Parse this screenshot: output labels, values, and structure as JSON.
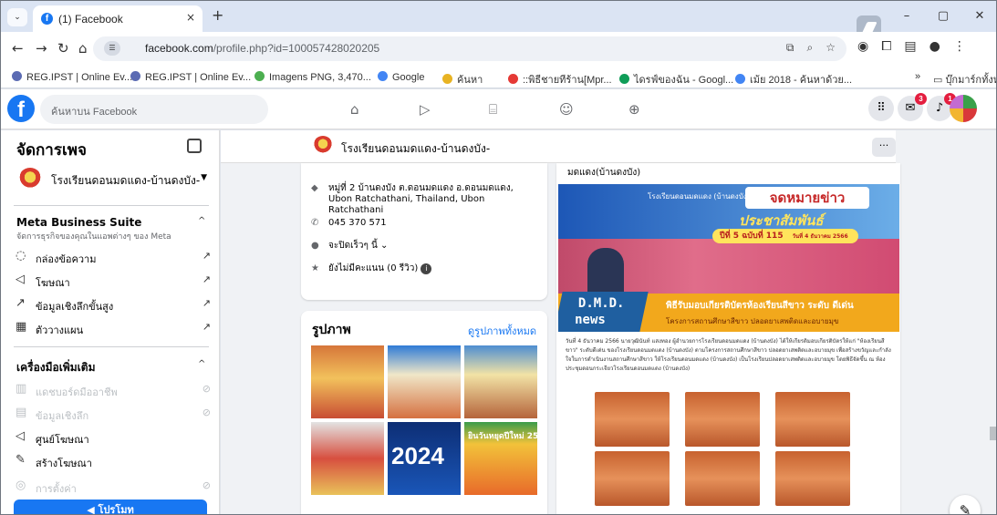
{
  "browser": {
    "tab_title": "(1) Facebook",
    "tab_close": "×",
    "new_tab": "+",
    "window_controls": [
      "–",
      "▢",
      "✕"
    ],
    "url_main": "facebook.com",
    "url_rest": "/profile.php?id=100057428020205",
    "bookmarks": [
      "REG.IPST | Online Ev...",
      "REG.IPST | Online Ev...",
      "Imagens PNG, 3,470...",
      "Google",
      "ค้นหา",
      "::พิธีชายทีร้าน[Mpr...",
      "ไดรฟ์ของฉัน - Googl...",
      "เม้ย 2018 - ค้นหาด้วย..."
    ],
    "bookmarks_more": "»",
    "all_bookmarks": "บุ๊กมาร์กทั้งหมด"
  },
  "fbnav": {
    "search_placeholder": "ค้นหาบน Facebook",
    "messenger_badge": "3",
    "notif_badge": "1"
  },
  "left": {
    "title": "จัดการเพจ",
    "page_name": "โรงเรียนดอนมดแดง-บ้านดงบัง-",
    "mbs_title": "Meta Business Suite",
    "mbs_sub": "จัดการธุรกิจของคุณในแอพต่างๆ ของ Meta",
    "mbs_items": [
      {
        "icon": "◌",
        "label": "กล่องข้อความ"
      },
      {
        "icon": "◁",
        "label": "โฆษณา"
      },
      {
        "icon": "↗",
        "label": "ข้อมูลเชิงลึกขั้นสูง"
      },
      {
        "icon": "▦",
        "label": "ตัววางแผน"
      }
    ],
    "tools_title": "เครื่องมือเพิ่มเติม",
    "tools_items": [
      {
        "icon": "▥",
        "label": "แดชบอร์ดมืออาชีพ",
        "disabled": true
      },
      {
        "icon": "▤",
        "label": "ข้อมูลเชิงลึก",
        "disabled": true
      },
      {
        "icon": "◁",
        "label": "ศูนย์โฆษณา",
        "disabled": false
      },
      {
        "icon": "✎",
        "label": "สร้างโฆษณา",
        "disabled": false
      },
      {
        "icon": "◎",
        "label": "การตั้งค่า",
        "disabled": true
      }
    ],
    "promote": "โปรโมท"
  },
  "main": {
    "page_name": "โรงเรียนดอนมดแดง-บ้านดงบัง-",
    "more": "···",
    "about": {
      "address": "หมู่ที่ 2 บ้านดงบัง ต.ดอนมดแดง อ.ดอนมดแดง, Ubon Ratchathani, Thailand, Ubon Ratchathani",
      "phone": "045 370 571",
      "hours": "จะปิดเร็วๆ นี้",
      "rating": "ยังไม่มีคะแนน (0 รีวิว)"
    },
    "photos_title": "รูปภาพ",
    "photos_all": "ดูรูปภาพทั้งหมด",
    "photo_tiles": [
      "",
      "",
      "",
      "",
      "2024",
      "ยินวันหยุดปีใหม่ 25"
    ],
    "post_caption": "มดแดง(บ้านดงบัง)",
    "news": {
      "org": "โรงเรียนดอนมดแดง (บ้านดงบัง)",
      "title": "จดหมายข่าว",
      "subtitle": "ประชาสัมพันธ์",
      "issue": "ปีที่ 5 ฉบับที่ 115",
      "date": "วันที่ 4 ธันวาคม 2566",
      "dmd1": "D.M.D.",
      "dmd2": "news",
      "headline": "พิธีรับมอบเกียรติบัตรห้องเรียนสีขาว ระดับ ดีเด่น",
      "sub": "โครงการสถานศึกษาสีขาว ปลอดยาเสพติดและอบายมุข",
      "body": "วันที่ 4 ธันวาคม 2566 นายวุฒินันท์ แสงทอง ผู้อำนวยการโรงเรียนดอนมดแดง (บ้านดงบัง) ได้ให้เกียรติมอบเกียรติบัตรให้แก่ \"ห้องเรียนสีขาว\" ระดับดีเด่น ของโรงเรียนดอนมดแดง (บ้านดงบัง) ตามโครงการสถานศึกษาสีขาว ปลอดยาเสพติดและอบายมุข เพื่อสร้างขวัญและกำลังใจในการดำเนินงานสถานศึกษาสีขาว ให้โรงเรียนดอนมดแดง (บ้านดงบัง) เป็นโรงเรียนปลอดยาเสพติดและอบายมุข โดยพิธีจัดขึ้น ณ ห้องประชุมดอนกระเจียวโรงเรียนดอนมดแดง (บ้านดงบัง)"
    }
  }
}
